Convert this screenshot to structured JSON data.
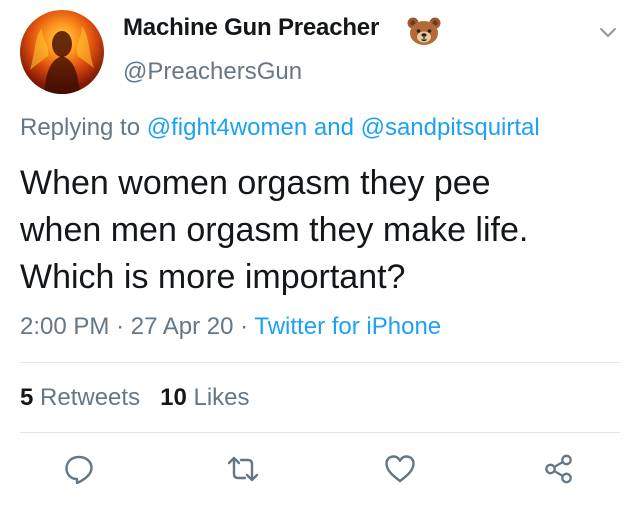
{
  "tweet": {
    "author_name": "Machine Gun Preacher",
    "author_emoji": "bear-face-emoji",
    "author_handle": "@PreachersGun",
    "replying_prefix": "Replying to",
    "replying_user_1": "@fight4women",
    "replying_joiner": "and",
    "replying_user_2": "@sandpitsquirtal",
    "text_lines": [
      "When women orgasm they pee",
      "when men orgasm they make life.",
      "Which is more important?"
    ],
    "time": "2:00 PM",
    "date": "27 Apr 20",
    "source": "Twitter for iPhone",
    "separator": "·",
    "retweets_count": "5",
    "retweets_label": "Retweets",
    "likes_count": "10",
    "likes_label": "Likes"
  },
  "icons": {
    "menu": "chevron-down-icon",
    "reply": "reply-icon",
    "retweet": "retweet-icon",
    "like": "heart-icon",
    "share": "share-icon"
  },
  "colors": {
    "link": "#1da1f2",
    "secondary_text": "#657786",
    "primary_text": "#14171a",
    "divider": "#e1e8ed"
  }
}
